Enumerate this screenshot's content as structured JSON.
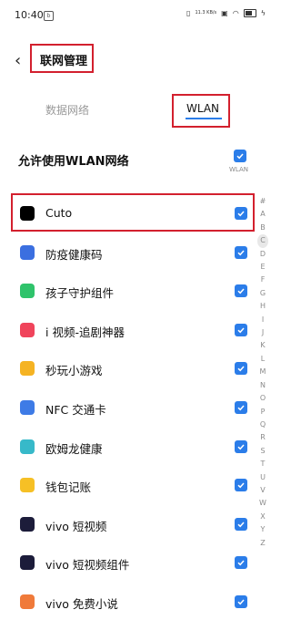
{
  "status": {
    "time": "10:40",
    "net_speed": "11.3 KB/s",
    "notif_glyph": "b"
  },
  "header": {
    "back_glyph": "‹",
    "title": "联网管理"
  },
  "tabs": [
    {
      "label": "数据网络"
    },
    {
      "label": "WLAN"
    }
  ],
  "allow": {
    "label": "允许使用WLAN网络",
    "sub": "WLAN"
  },
  "apps": [
    {
      "label": "Cuto",
      "icon": "cuto-icon",
      "color": "#000000"
    },
    {
      "label": "防疫健康码",
      "icon": "health-code-icon",
      "color": "#3b6fe0"
    },
    {
      "label": "孩子守护组件",
      "icon": "kid-guard-icon",
      "color": "#2fc36b"
    },
    {
      "label": "i 视频-追剧神器",
      "icon": "ivideo-icon",
      "color": "#f0445b"
    },
    {
      "label": "秒玩小游戏",
      "icon": "mini-game-icon",
      "color": "#f5b323"
    },
    {
      "label": "NFC 交通卡",
      "icon": "nfc-card-icon",
      "color": "#3e7be6"
    },
    {
      "label": "欧姆龙健康",
      "icon": "omron-icon",
      "color": "#37b9c9"
    },
    {
      "label": "钱包记账",
      "icon": "wallet-icon",
      "color": "#f6c025"
    },
    {
      "label": "vivo 短视频",
      "icon": "vivo-video-icon",
      "color": "#1c1c3a"
    },
    {
      "label": "vivo 短视频组件",
      "icon": "vivo-video-widget-icon",
      "color": "#1c1c3a"
    },
    {
      "label": "vivo 免费小说",
      "icon": "vivo-novel-icon",
      "color": "#f07a3a"
    }
  ],
  "alphabet": [
    "#",
    "A",
    "B",
    "C",
    "D",
    "E",
    "F",
    "G",
    "H",
    "I",
    "J",
    "K",
    "L",
    "M",
    "N",
    "O",
    "P",
    "Q",
    "R",
    "S",
    "T",
    "U",
    "V",
    "W",
    "X",
    "Y",
    "Z"
  ],
  "alphabet_selected": "C",
  "colors": {
    "accent": "#2b7de9",
    "highlight": "#d3202e"
  }
}
